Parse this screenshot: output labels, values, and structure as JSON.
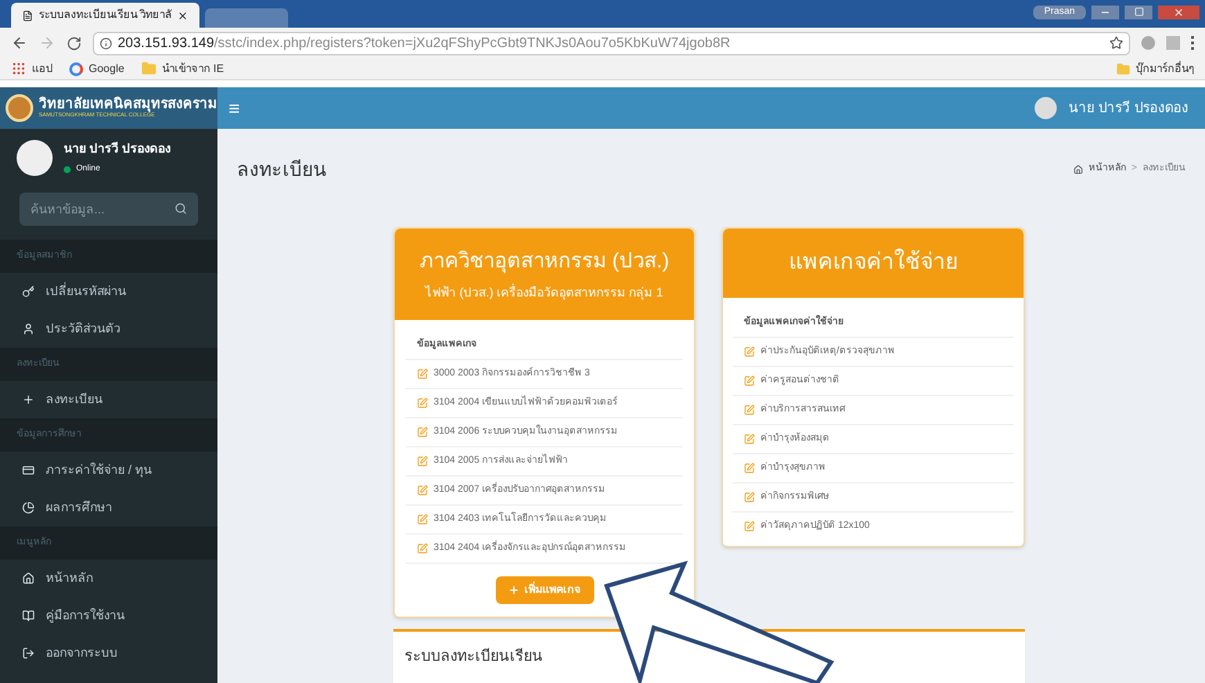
{
  "browser": {
    "tab_title": "ระบบลงทะเบียนเรียน วิทยาลั",
    "window_user": "Prasan",
    "url_host": "203.151.93.149",
    "url_path": "/sstc/index.php/registers?token=jXu2qFShyPcGbt9TNKJs0Aou7o5KbKuW74jgob8R",
    "bookmarks": [
      {
        "kind": "apps",
        "label": "แอป"
      },
      {
        "kind": "google",
        "label": "Google"
      },
      {
        "kind": "folder",
        "label": "นำเข้าจาก IE"
      }
    ],
    "other_bookmarks": "บุ๊กมาร์กอื่นๆ"
  },
  "header": {
    "college_name": "วิทยาลัยเทคนิคสมุทรสงคราม",
    "college_name_en": "SAMUTSONGKHRAM TECHNICAL COLLEGE",
    "menu_glyph": "≡",
    "user_name": "นาย ปารวี ปรองดอง"
  },
  "sidebar": {
    "user_name": "นาย ปารวี ปรองดอง",
    "status": "Online",
    "search": {
      "placeholder": "ค้นหาข้อมูล..."
    },
    "sections": [
      {
        "title": "ข้อมูลสมาชิก",
        "items": [
          {
            "label": "เปลี่ยนรหัสผ่าน"
          },
          {
            "label": "ประวัติส่วนตัว"
          }
        ]
      },
      {
        "title": "ลงทะเบียน",
        "items": [
          {
            "label": "ลงทะเบียน"
          }
        ]
      },
      {
        "title": "ข้อมูลการศึกษา",
        "items": [
          {
            "label": "ภาระค่าใช้จ่าย / ทุน"
          },
          {
            "label": "ผลการศึกษา"
          }
        ]
      },
      {
        "title": "เมนูหลัก",
        "items": [
          {
            "label": "หน้าหลัก"
          },
          {
            "label": "คู่มือการใช้งาน"
          },
          {
            "label": "ออกจากระบบ"
          }
        ]
      }
    ]
  },
  "page": {
    "title": "ลงทะเบียน",
    "breadcrumb": [
      "หน้าหลัก",
      "ลงทะเบียน"
    ],
    "breadcrumb_separator": ">"
  },
  "course_card": {
    "title": "ภาควิชาอุตสาหกรรม (ปวส.)",
    "subtitle": "ไฟฟ้า (ปวส.) เครื่องมือวัดอุตสาหกรรม กลุ่ม 1",
    "section": "ข้อมูลแพคเกจ",
    "items": [
      "3000 2003 กิจกรรมองค์การวิชาชีพ 3",
      "3104 2004 เขียนแบบไฟฟ้าด้วยคอมพิวเตอร์",
      "3104 2006 ระบบควบคุมในงานอุตสาหกรรม",
      "3104 2005 การส่งและจ่ายไฟฟ้า",
      "3104 2007 เครื่องปรับอากาศอุตสาหกรรม",
      "3104 2403 เทคโนโลยีการวัดและควบคุม",
      "3104 2404 เครื่องจักรและอุปกรณ์อุตสาหกรรม"
    ],
    "button": "เพิ่มแพคเกจ"
  },
  "fee_card": {
    "title": "แพคเกจค่าใช้จ่าย",
    "section": "ข้อมูลแพคเกจค่าใช้จ่าย",
    "items": [
      "ค่าประกันอุบัติเหตุ/ตรวจสุขภาพ",
      "ค่าครูสอนต่างชาติ",
      "ค่าบริการสารสนเทศ",
      "ค่าบำรุงห้องสมุด",
      "ค่าบำรุงสุขภาพ",
      "ค่ากิจกรรมพิเศษ",
      "ค่าวัสดุภาคปฏิบัติ 12x100"
    ]
  },
  "bottom_box": {
    "title": "ระบบลงทะเบียนเรียน"
  }
}
